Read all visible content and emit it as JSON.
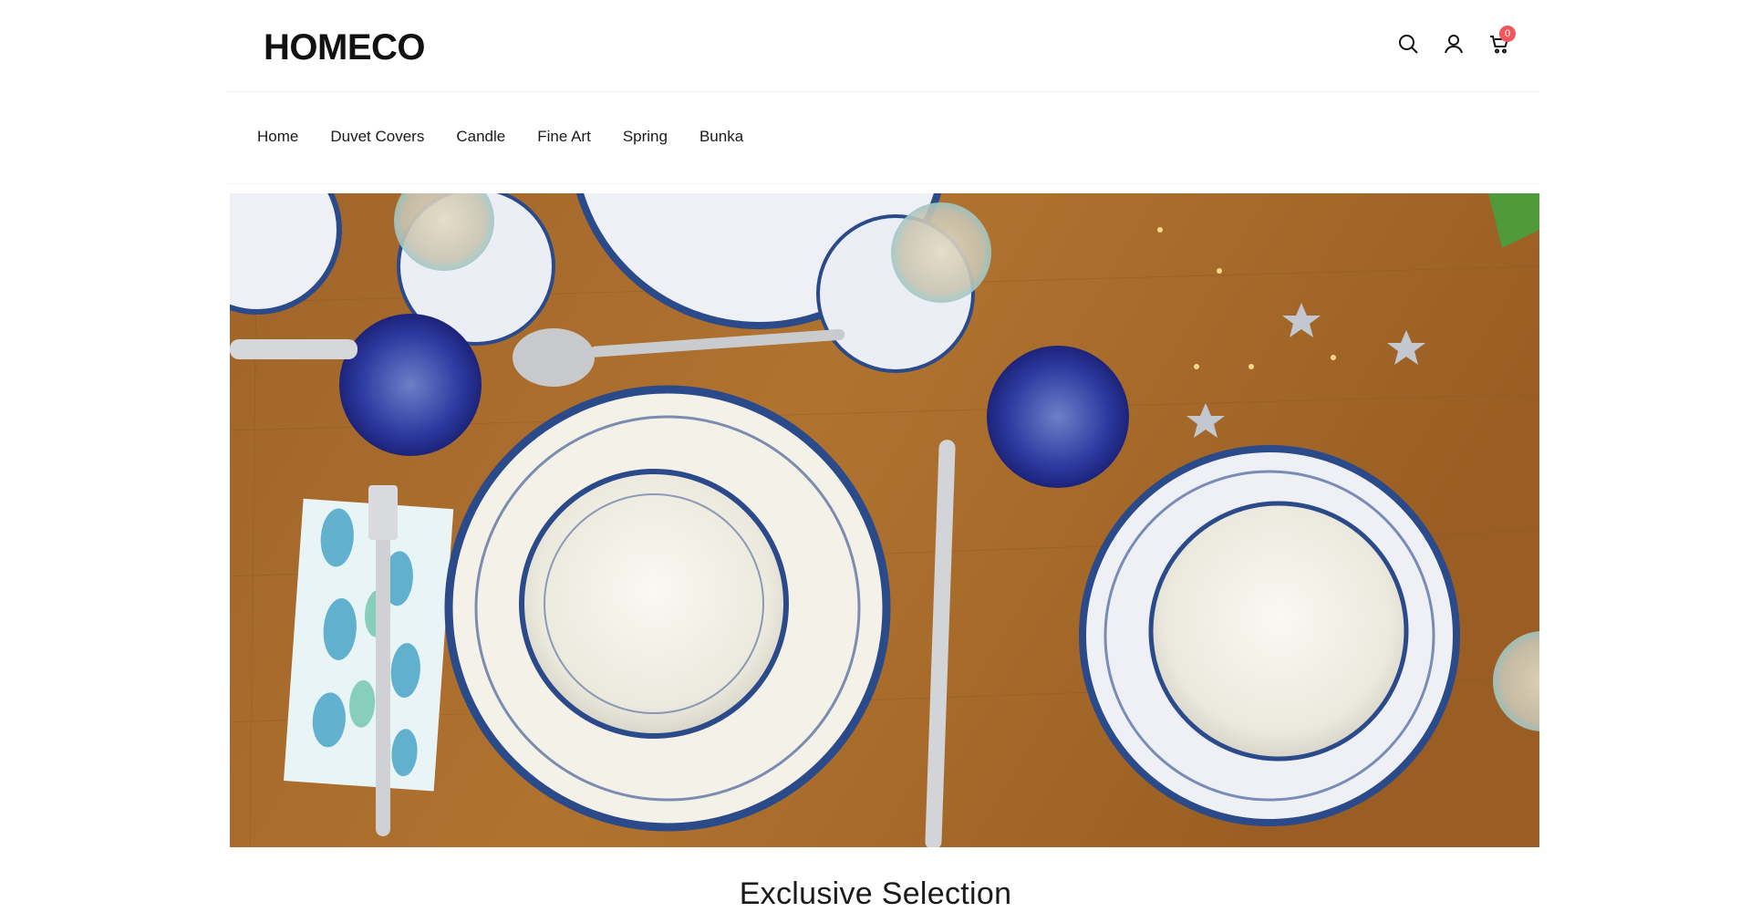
{
  "header": {
    "logo": "HOMECO",
    "cart_count": "0"
  },
  "nav": {
    "items": [
      "Home",
      "Duvet Covers",
      "Candle",
      "Fine Art",
      "Spring",
      "Bunka"
    ]
  },
  "icons": {
    "search": "search-icon",
    "account": "user-icon",
    "cart": "cart-icon"
  },
  "hero": {
    "image": "table-setting-photo"
  },
  "section": {
    "title": "Exclusive Selection"
  },
  "colors": {
    "badge": "#f0565b",
    "wood": "#a8692a",
    "plate_blue": "#2b4a8a"
  }
}
